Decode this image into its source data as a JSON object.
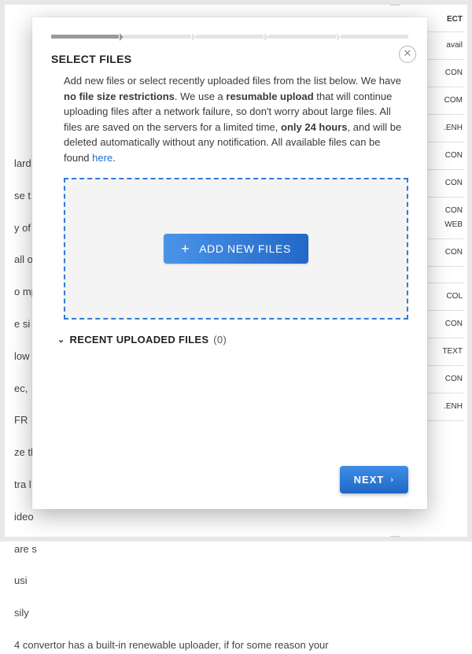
{
  "background": {
    "left_snips": [
      "lard",
      "se t",
      "",
      "y of",
      "all o",
      "",
      "o mp",
      "",
      "e si",
      "",
      "low",
      "ec,",
      "",
      "FR",
      "",
      "ze th",
      "tra l",
      "ideo",
      "are s",
      "",
      "usi",
      "sily"
    ],
    "bottom_line": "4 convertor has a built-in renewable uploader, if for some reason your",
    "right_head": "ECT",
    "right_sub": "avail",
    "right_items": [
      "CON",
      "COM",
      "ENH.",
      "CON",
      "CON",
      "CON",
      "WEB",
      "CON",
      "",
      "COL",
      "CON",
      "TEXT",
      "CON",
      "ENH."
    ]
  },
  "modal": {
    "heading": "SELECT FILES",
    "desc_parts": {
      "p1": "Add new files or select recently uploaded files from the list below. We have ",
      "b1": "no file size restrictions",
      "p2": ". We use a ",
      "b2": "resumable upload",
      "p3": " that will continue uploading files after a network failure, so don't worry about large files. All files are saved on the servers for a limited time, ",
      "b3": "only 24 hours",
      "p4": ", and will be deleted automatically without any notification. All available files can be found ",
      "link": "here",
      "p5": "."
    },
    "add_button": "ADD NEW FILES",
    "recent_label": "RECENT UPLOADED FILES",
    "recent_count": "(0)",
    "next_button": "NEXT"
  }
}
